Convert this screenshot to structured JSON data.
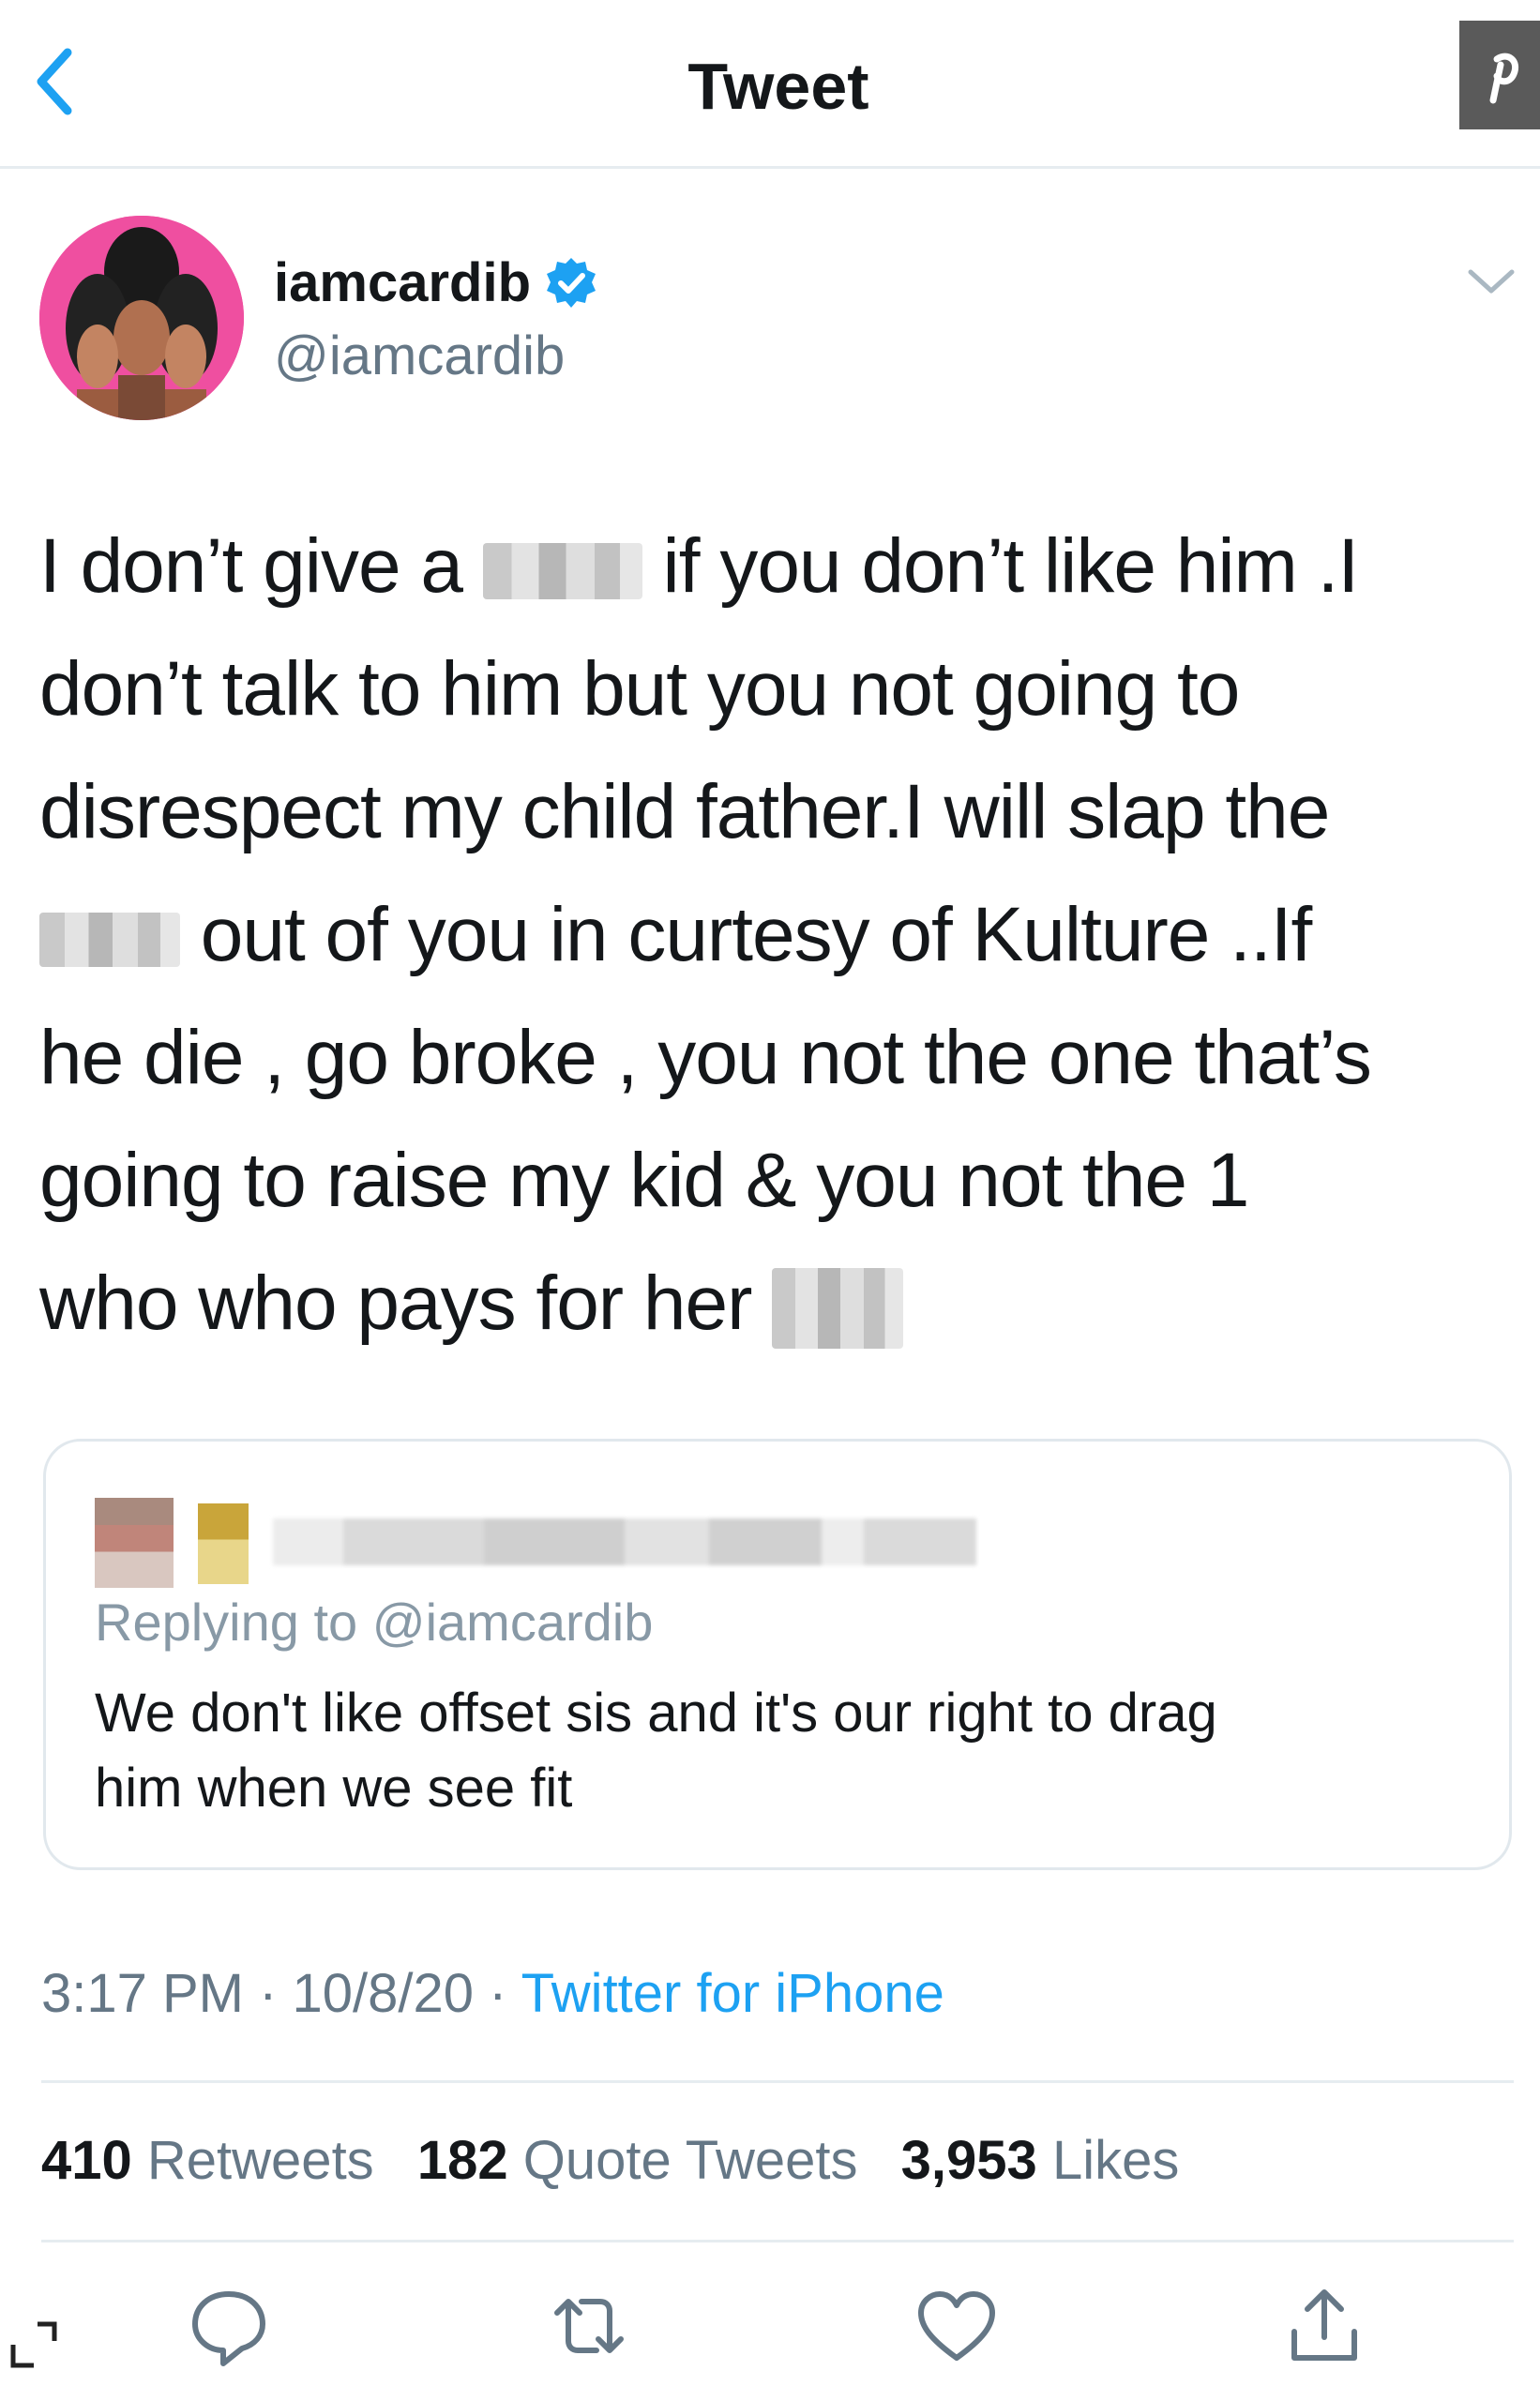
{
  "header": {
    "title": "Tweet"
  },
  "author": {
    "name": "iamcardib",
    "handle": "@iamcardib"
  },
  "tweet": {
    "line1_a": "I don’t give a ",
    "line1_b": " if you don’t like him .I",
    "line2": "don’t talk to him but you not going to",
    "line3": "disrespect my child father.I will slap the",
    "line4": " out of you in curtesy of Kulture ..If",
    "line5": "he die , go broke , you not the one that’s",
    "line6": "going to raise my kid & you not the 1",
    "line7": "who who pays for her "
  },
  "quoted_tweet": {
    "replying_prefix": "Replying to ",
    "replying_to": "@iamcardib",
    "text_line1": "We don't like offset sis and it's our right to drag",
    "text_line2": "him when we see fit"
  },
  "meta": {
    "time": "3:17 PM",
    "date": "10/8/20",
    "separator": " · ",
    "source": "Twitter for iPhone"
  },
  "stats": {
    "retweets_count": "410",
    "retweets_label": "Retweets",
    "quotes_count": "182",
    "quotes_label": "Quote Tweets",
    "likes_count": "3,953",
    "likes_label": "Likes"
  },
  "colors": {
    "accent": "#1da1f2",
    "secondary_text": "#657786",
    "divider": "#e6ecf0",
    "avatar_bg": "#ef4fa0"
  },
  "icons": {
    "back": "chevron-left-icon",
    "pinterest": "pinterest-icon",
    "verified": "verified-badge-icon",
    "caret": "chevron-down-icon",
    "reply": "reply-icon",
    "retweet": "retweet-icon",
    "like": "heart-icon",
    "share": "share-icon",
    "expand": "expand-icon"
  }
}
